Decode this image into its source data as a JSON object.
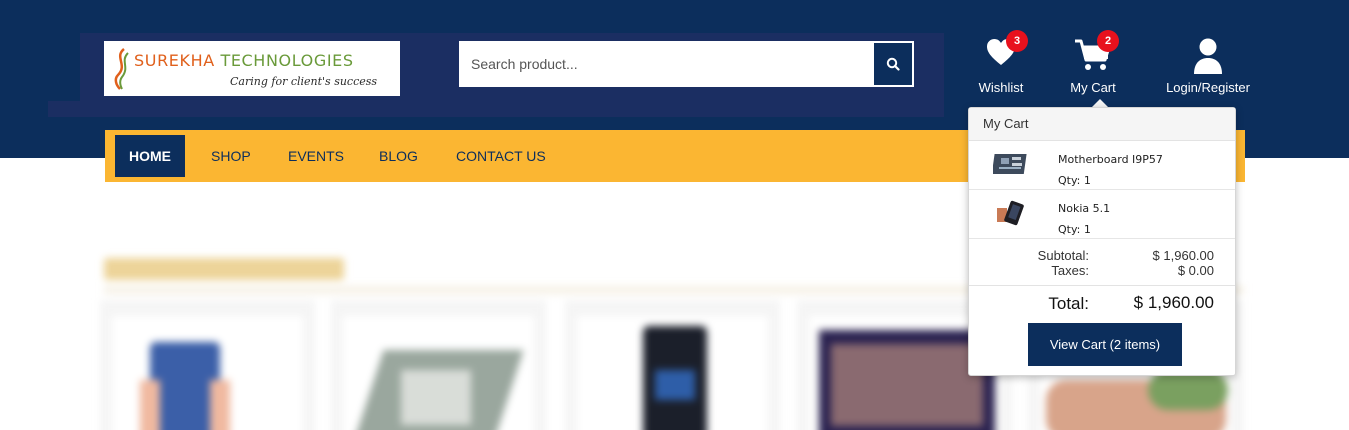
{
  "brand": {
    "name_part1": "SUREKHA",
    "name_part2": "TECHNOLOGIES",
    "tagline": "Caring for client's success"
  },
  "search": {
    "placeholder": "Search product...",
    "button_icon": "search-icon"
  },
  "header_links": {
    "wishlist": {
      "label": "Wishlist",
      "icon": "heart-icon",
      "badge": "3"
    },
    "cart": {
      "label": "My Cart",
      "icon": "cart-icon",
      "badge": "2"
    },
    "account": {
      "label": "Login/Register",
      "icon": "user-icon"
    }
  },
  "nav": {
    "items": [
      {
        "label": "HOME",
        "active": true
      },
      {
        "label": "SHOP",
        "active": false
      },
      {
        "label": "EVENTS",
        "active": false
      },
      {
        "label": "BLOG",
        "active": false
      },
      {
        "label": "CONTACT US",
        "active": false
      }
    ]
  },
  "cart_dropdown": {
    "title": "My Cart",
    "items": [
      {
        "name": "Motherboard I9P57",
        "qty": "Qty: 1",
        "thumb": "motherboard-thumbnail"
      },
      {
        "name": "Nokia 5.1",
        "qty": "Qty: 1",
        "thumb": "phone-thumbnail"
      }
    ],
    "subtotal_label": "Subtotal:",
    "subtotal_value": "$ 1,960.00",
    "taxes_label": "Taxes:",
    "taxes_value": "$ 0.00",
    "total_label": "Total:",
    "total_value": "$ 1,960.00",
    "view_cart_label": "View Cart (2 items)"
  },
  "colors": {
    "header_bg": "#0c2e5c",
    "nav_bg": "#fbb632",
    "badge": "#e8111d",
    "button_bg": "#0c2e5c"
  }
}
